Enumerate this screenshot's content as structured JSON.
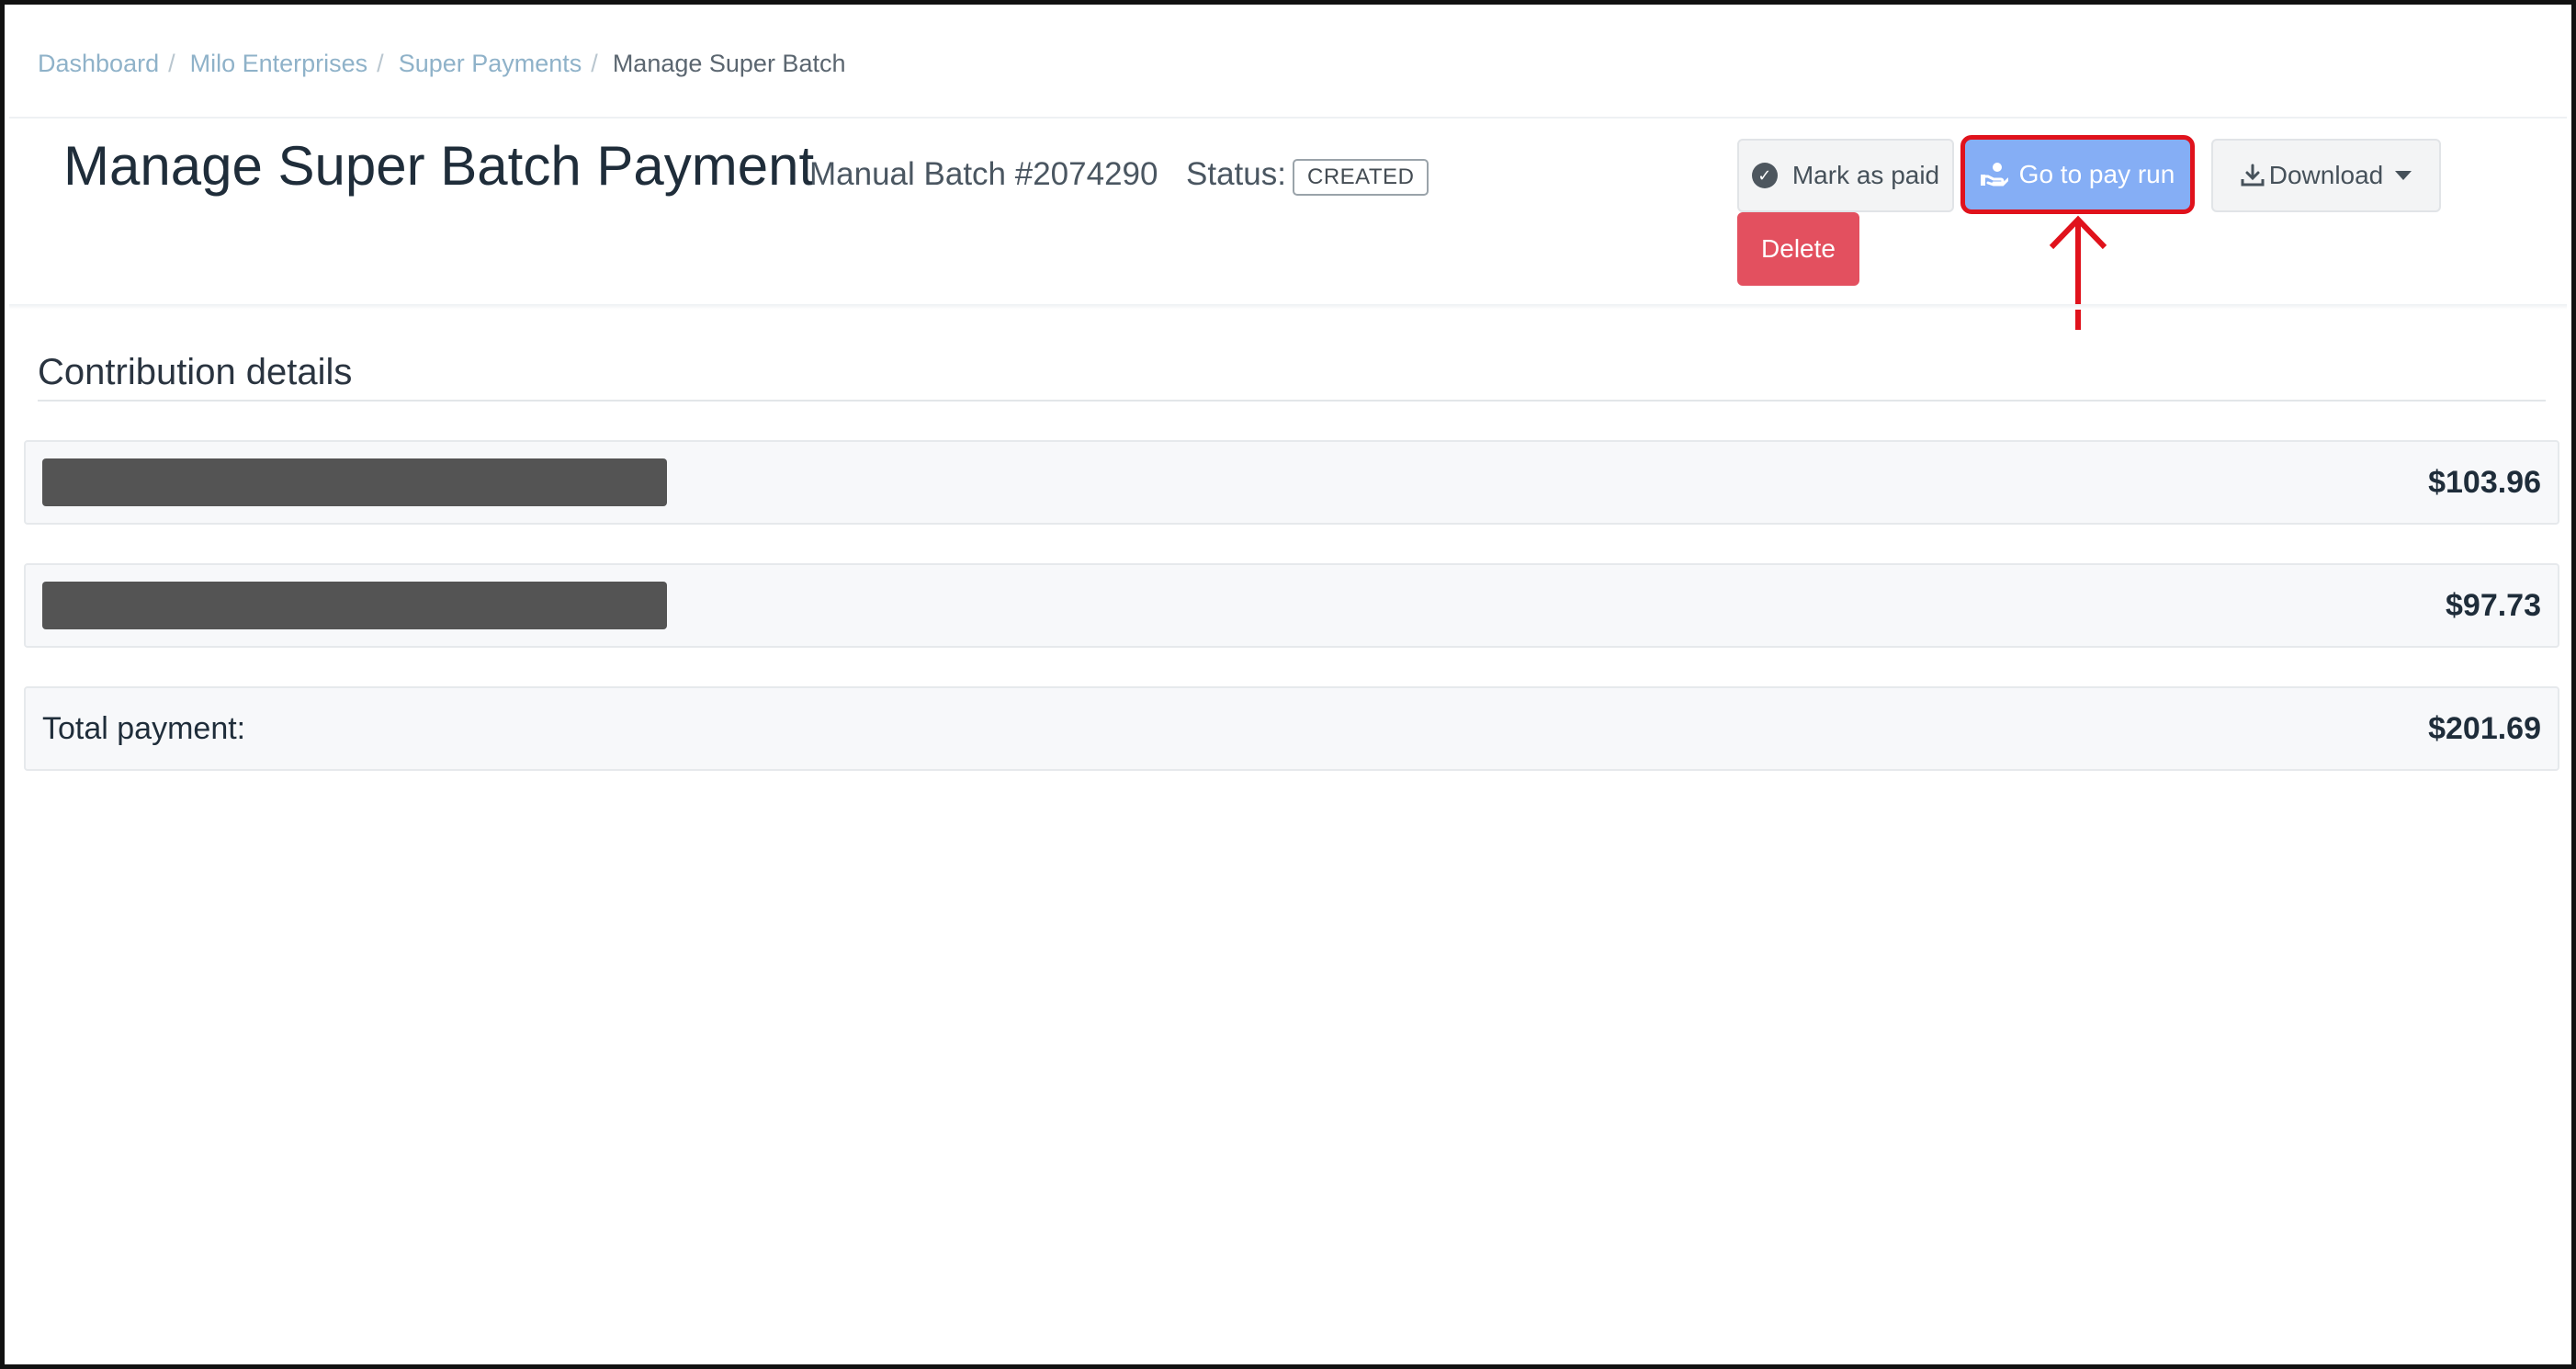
{
  "breadcrumb": {
    "items": [
      "Dashboard",
      "Milo Enterprises",
      "Super Payments"
    ],
    "current": "Manage Super Batch",
    "separator": "/"
  },
  "header": {
    "title": "Manage Super Batch Payment",
    "batch": "Manual Batch #2074290",
    "status_label": "Status:",
    "status_value": "CREATED"
  },
  "actions": {
    "mark_as_paid": "Mark as paid",
    "go_to_pay_run": "Go to pay run",
    "download": "Download",
    "delete": "Delete"
  },
  "contributions": {
    "title": "Contribution details",
    "rows": [
      {
        "amount": "$103.96"
      },
      {
        "amount": "$97.73"
      }
    ],
    "total_label": "Total payment:",
    "total_amount": "$201.69"
  },
  "colors": {
    "accent_blue": "#85aef5",
    "danger_red": "#e3505f",
    "annotation_red": "#e0121c"
  }
}
